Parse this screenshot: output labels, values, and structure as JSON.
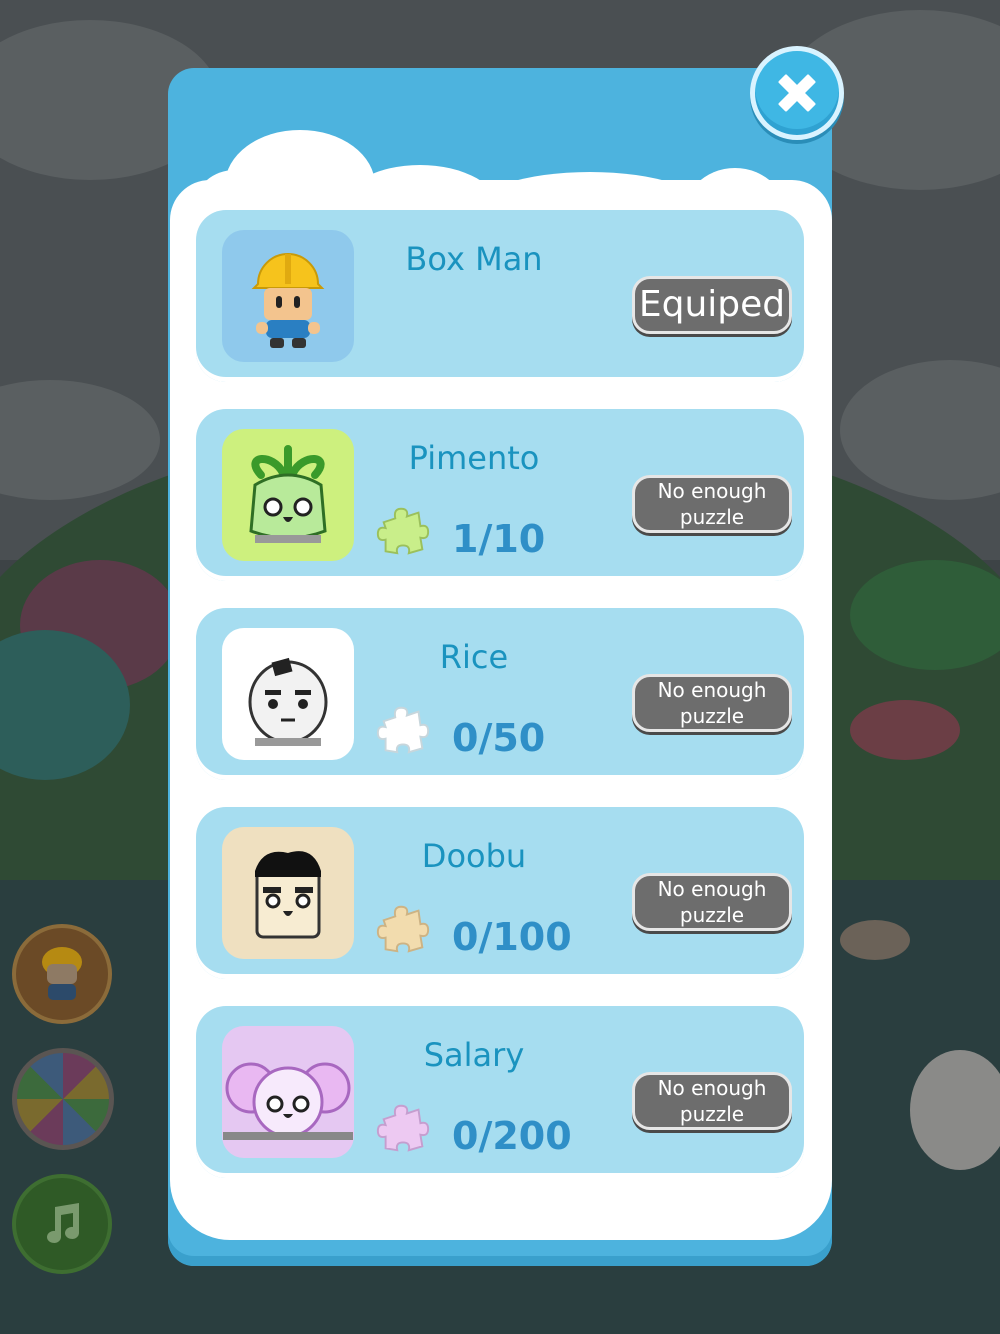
{
  "characters": [
    {
      "name": "Box Man",
      "progress": "",
      "button": "Equiped",
      "puzzle_color": "#000000",
      "avatar_bg": "#8fc9ec"
    },
    {
      "name": "Pimento",
      "progress": "1/10",
      "button": "No enough\npuzzle",
      "puzzle_color": "#c9ee8a",
      "avatar_bg": "#cdf07e"
    },
    {
      "name": "Rice",
      "progress": "0/50",
      "button": "No enough\npuzzle",
      "puzzle_color": "#ffffff",
      "avatar_bg": "#ffffff"
    },
    {
      "name": "Doobu",
      "progress": "0/100",
      "button": "No enough\npuzzle",
      "puzzle_color": "#f2dcae",
      "avatar_bg": "#efe0c0"
    },
    {
      "name": "Salary",
      "progress": "0/200",
      "button": "No enough\npuzzle",
      "puzzle_color": "#edc9f2",
      "avatar_bg": "#e5c8f2"
    }
  ],
  "icons": {
    "close": "close-icon",
    "puzzle": "puzzle-piece-icon",
    "music": "music-note-icon",
    "wheel": "lucky-wheel-icon",
    "character": "character-icon"
  },
  "colors": {
    "panel": "#4db3de",
    "card": "#a6ddf0",
    "name_text": "#1a93bf",
    "count_text": "#2f8fc7",
    "button": "#6d6d6d"
  }
}
